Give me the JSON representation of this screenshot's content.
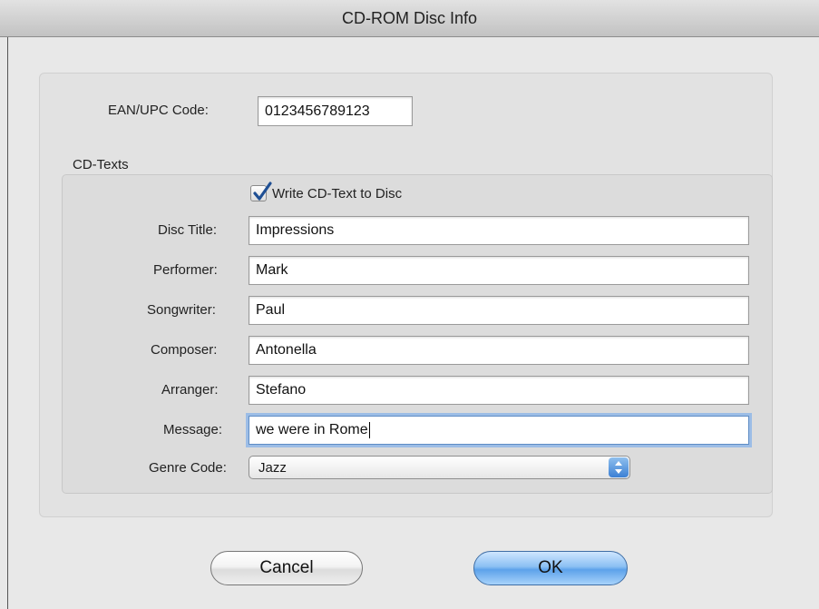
{
  "window": {
    "title": "CD-ROM Disc Info"
  },
  "ean": {
    "label": "EAN/UPC Code:",
    "value": "0123456789123"
  },
  "cd_texts": {
    "section_title": "CD-Texts",
    "write_checkbox": {
      "label": "Write CD-Text to Disc",
      "checked": true
    },
    "fields": {
      "disc_title": {
        "label": "Disc Title:",
        "value": "Impressions"
      },
      "performer": {
        "label": "Performer:",
        "value": "Mark"
      },
      "songwriter": {
        "label": "Songwriter:",
        "value": "Paul"
      },
      "composer": {
        "label": "Composer:",
        "value": "Antonella"
      },
      "arranger": {
        "label": "Arranger:",
        "value": "Stefano"
      },
      "message": {
        "label": "Message:",
        "value": "we were in Rome"
      }
    },
    "genre": {
      "label": "Genre Code:",
      "selected": "Jazz"
    }
  },
  "buttons": {
    "cancel": "Cancel",
    "ok": "OK"
  },
  "colors": {
    "accent": "#5da2ea",
    "focus_ring": "#9cbde6"
  }
}
